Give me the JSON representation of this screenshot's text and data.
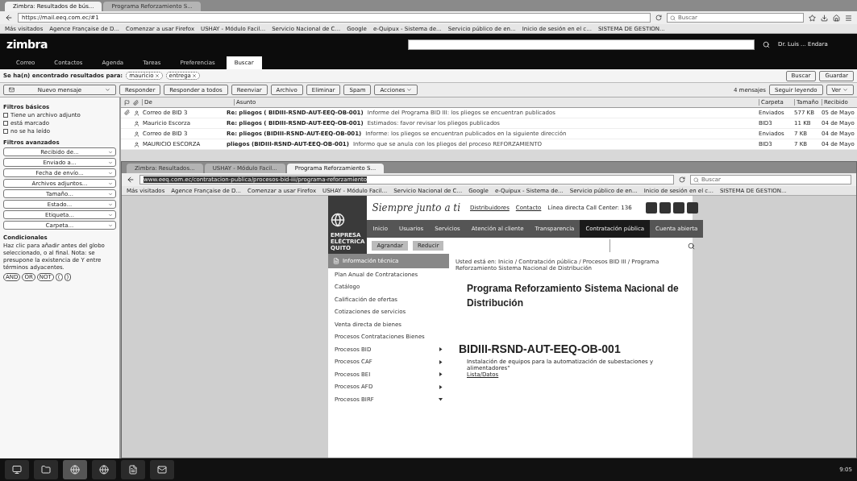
{
  "browser": {
    "tabs": [
      {
        "label": "Zimbra: Resultados de bús...",
        "selected": true
      },
      {
        "label": "Programa Reforzamiento S...",
        "selected": false
      }
    ],
    "url": "https://mail.eeq.com.ec/#1",
    "search_placeholder": "Buscar",
    "bookmarks": [
      "Más visitados",
      "Agence Française de D...",
      "Comenzar a usar Firefox",
      "USHAY - Módulo Facil...",
      "Servicio Nacional de C...",
      "Google",
      "e-Quipux - Sistema de...",
      "Servicio público de en...",
      "Inicio de sesión en el c...",
      "SISTEMA DE GESTION..."
    ]
  },
  "zimbra": {
    "logo": "zimbra",
    "user": "Dr. Luis ... Endara",
    "nav": [
      {
        "label": "Correo",
        "selected": false
      },
      {
        "label": "Contactos",
        "selected": false
      },
      {
        "label": "Agenda",
        "selected": false
      },
      {
        "label": "Tareas",
        "selected": false
      },
      {
        "label": "Preferencias",
        "selected": false
      },
      {
        "label": "Buscar",
        "selected": true
      }
    ],
    "results_label": "Se ha(n) encontrado resultados para:",
    "chips": [
      "mauricio",
      "entrega"
    ],
    "search_buttons": [
      "Buscar",
      "Guardar"
    ],
    "new_message": "Nuevo mensaje",
    "toolbar": [
      "Responder",
      "Responder a todos",
      "Reenviar",
      "Archivo",
      "Eliminar",
      "Spam"
    ],
    "actions": "Acciones",
    "message_count": "4 mensajes",
    "reading_pane": "Seguir leyendo",
    "view": "Ver"
  },
  "sidebar": {
    "basic_title": "Filtros básicos",
    "basic": [
      {
        "label": "Tiene un archivo adjunto",
        "checked": false
      },
      {
        "label": "está marcado",
        "checked": false
      },
      {
        "label": "no se ha leído",
        "checked": false
      }
    ],
    "advanced_title": "Filtros avanzados",
    "advanced": [
      "Recibido de...",
      "Enviado a...",
      "Fecha de envío...",
      "Archivos adjuntos...",
      "Tamaño...",
      "Estado...",
      "Etiqueta...",
      "Carpeta..."
    ],
    "conditional_title": "Condicionales",
    "conditional_note": "Haz clic para añadir antes del globo seleccionado, o al final. Nota: se presupone la existencia de Y entre términos adyacentes.",
    "operators": [
      "AND",
      "OR",
      "NOT",
      "(",
      ")"
    ]
  },
  "messages": {
    "columns": [
      "De",
      "Asunto",
      "Carpeta",
      "Tamaño",
      "Recibido"
    ],
    "rows": [
      {
        "from": "Correo de BID 3",
        "subject": "Re: pliegos ( BIDIII-RSND-AUT-EEQ-OB-001)",
        "snippet": "Informe del Programa BID III: los pliegos se encuentran publicados",
        "folder": "Enviados",
        "size": "577 KB",
        "date": "05 de Mayo",
        "attachment": true
      },
      {
        "from": "Mauricio Escorza",
        "subject": "Re: pliegos ( BIDIII-RSND-AUT-EEQ-OB-001)",
        "snippet": "Estimados: favor revisar los pliegos publicados",
        "folder": "BID3",
        "size": "11 KB",
        "date": "04 de Mayo",
        "attachment": false
      },
      {
        "from": "Correo de BID 3",
        "subject": "Re: pliegos (BIDIII-RSND-AUT-EEQ-OB-001)",
        "snippet": "Informe: los pliegos se encuentran publicados en la siguiente dirección",
        "folder": "Enviados",
        "size": "7 KB",
        "date": "04 de Mayo",
        "attachment": false
      },
      {
        "from": "MAURICIO ESCORZA",
        "subject": "pliegos (BIDIII-RSND-AUT-EEQ-OB-001)",
        "snippet": "Informo que se anula con los pliegos del proceso REFORZAMIENTO",
        "folder": "BID3",
        "size": "7 KB",
        "date": "04 de Mayo",
        "attachment": false
      }
    ]
  },
  "inner_browser": {
    "tabs": [
      {
        "label": "Zimbra: Resultados...",
        "selected": false
      },
      {
        "label": "USHAY - Módulo Facil...",
        "selected": false
      },
      {
        "label": "Programa Reforzamiento S...",
        "selected": true
      }
    ],
    "url": "www.eeq.com.ec/contratacion-publica/procesos-bid-iii/programa-reforzamiento",
    "search_placeholder": "Buscar",
    "bookmarks": [
      "Más visitados",
      "Agence Française de D...",
      "Comenzar a usar Firefox",
      "USHAY - Módulo Facil...",
      "Servicio Nacional de C...",
      "Google",
      "e-Quipux - Sistema de...",
      "Servicio público de en...",
      "Inicio de sesión en el c...",
      "SISTEMA DE GESTION..."
    ]
  },
  "site": {
    "logo_text": "EMPRESA ELÉCTRICA QUITO",
    "slogan": "Siempre junto a ti",
    "links": [
      "Distribuidores",
      "Contacto"
    ],
    "hotline": "Línea directa Call Center: 136",
    "nav": [
      {
        "label": "Inicio",
        "selected": false
      },
      {
        "label": "Usuarios",
        "selected": false
      },
      {
        "label": "Servicios",
        "selected": false
      },
      {
        "label": "Atención al cliente",
        "selected": false
      },
      {
        "label": "Transparencia",
        "selected": false
      },
      {
        "label": "Contratación pública",
        "selected": true
      },
      {
        "label": "Cuenta abierta",
        "selected": false
      }
    ],
    "text_buttons": [
      "Agrandar",
      "Reducir"
    ],
    "menu_title": "Información técnica",
    "menu": [
      {
        "label": "Plan Anual de Contrataciones",
        "kind": "link"
      },
      {
        "label": "Catálogo",
        "kind": "link"
      },
      {
        "label": "Calificación de ofertas",
        "kind": "link"
      },
      {
        "label": "Cotizaciones de servicios",
        "kind": "link"
      },
      {
        "label": "Venta directa de bienes",
        "kind": "link"
      },
      {
        "label": "Procesos Contrataciones Bienes",
        "kind": "link"
      },
      {
        "label": "Procesos BID",
        "kind": "submenu",
        "expanded": false
      },
      {
        "label": "Procesos CAF",
        "kind": "submenu",
        "expanded": false
      },
      {
        "label": "Procesos BEI",
        "kind": "submenu",
        "expanded": false
      },
      {
        "label": "Procesos AFD",
        "kind": "submenu",
        "expanded": false
      },
      {
        "label": "Procesos BIRF",
        "kind": "submenu",
        "expanded": true
      }
    ],
    "breadcrumb": "Usted está en: Inicio / Contratación pública / Procesos BID III / Programa Reforzamiento Sistema Nacional de Distribución",
    "title": "Programa Reforzamiento Sistema Nacional de Distribución",
    "code": "BIDIII-RSND-AUT-EEQ-OB-001",
    "description": "Instalación de equipos para la automatización de subestaciones y alimentadores\"",
    "link": "Lista/Datos"
  },
  "taskbar": {
    "time": "9:05"
  }
}
